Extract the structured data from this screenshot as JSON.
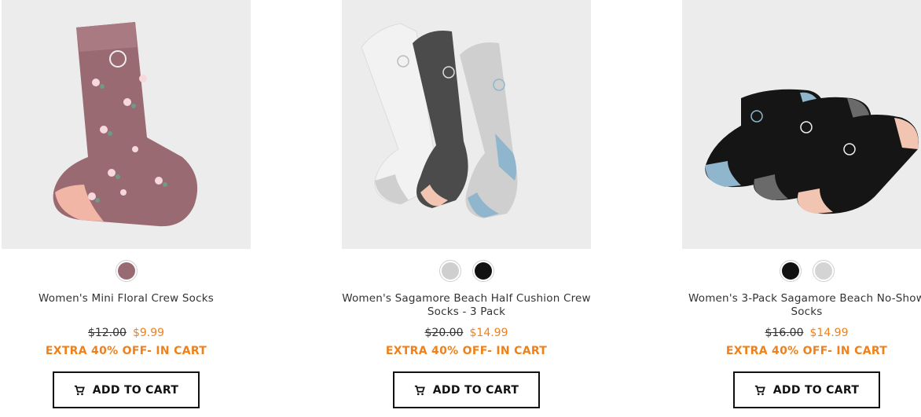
{
  "products": [
    {
      "name": "Women's Mini Floral Crew Socks",
      "old_price": "$12.00",
      "price": "$9.99",
      "promo": "EXTRA 40% OFF- IN CART",
      "swatches": [
        {
          "color": "#9a6a72",
          "selected": true
        }
      ],
      "cta": "ADD TO CART"
    },
    {
      "name": "Women's Sagamore Beach Half Cushion Crew Socks - 3 Pack",
      "old_price": "$20.00",
      "price": "$14.99",
      "promo": "EXTRA 40% OFF- IN CART",
      "swatches": [
        {
          "color": "#cfcfcf",
          "selected": false
        },
        {
          "color": "#111111",
          "selected": false
        }
      ],
      "cta": "ADD TO CART"
    },
    {
      "name": "Women's 3-Pack Sagamore Beach No-Show Socks",
      "old_price": "$16.00",
      "price": "$14.99",
      "promo": "EXTRA 40% OFF- IN CART",
      "swatches": [
        {
          "color": "#111111",
          "selected": false
        },
        {
          "color": "#d4d4d4",
          "selected": false
        }
      ],
      "cta": "ADD TO CART"
    }
  ],
  "colors": {
    "accent_orange": "#f0811a",
    "image_bg": "#ececec",
    "text": "#333333"
  }
}
